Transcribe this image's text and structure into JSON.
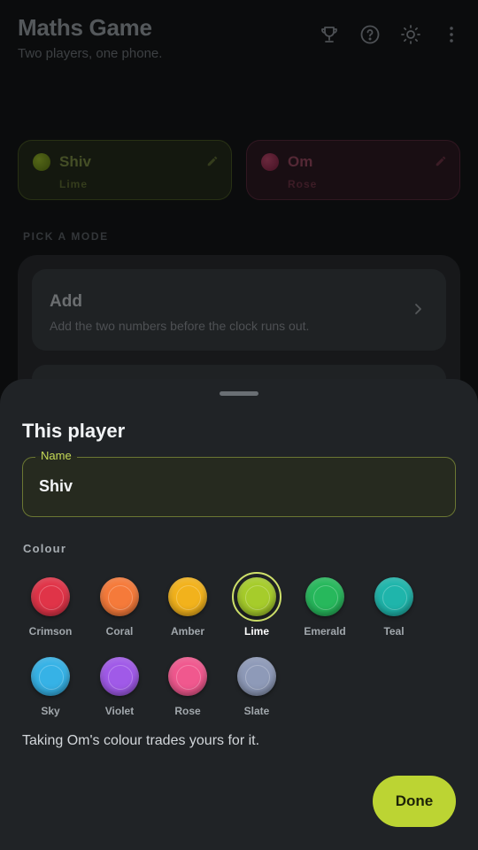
{
  "app": {
    "title": "Maths Game",
    "subtitle": "Two players, one phone.",
    "header_icons": [
      "trophy-icon",
      "help-icon",
      "brightness-icon",
      "more-vert-icon"
    ]
  },
  "players": [
    {
      "name": "Shiv",
      "colour_name": "Lime",
      "colour": "#8fb320",
      "text_color": "#7d8f45",
      "sub_color": "#5f6e34"
    },
    {
      "name": "Om",
      "colour_name": "Rose",
      "colour": "#b8355e",
      "text_color": "#9a4a62",
      "sub_color": "#6e3345"
    }
  ],
  "modes": {
    "section_label": "PICK A MODE",
    "items": [
      {
        "title": "Add",
        "description": "Add the two numbers before the clock runs out."
      }
    ]
  },
  "sheet": {
    "title": "This player",
    "name_field": {
      "label": "Name",
      "value": "Shiv"
    },
    "colour_label": "Colour",
    "colours": [
      {
        "name": "Crimson",
        "hex": "#e03448",
        "selected": false
      },
      {
        "name": "Coral",
        "hex": "#f57a3a",
        "selected": false
      },
      {
        "name": "Amber",
        "hex": "#f2b21c",
        "selected": false
      },
      {
        "name": "Lime",
        "hex": "#a6cc2b",
        "selected": true
      },
      {
        "name": "Emerald",
        "hex": "#27b85c",
        "selected": false
      },
      {
        "name": "Teal",
        "hex": "#1fb5ab",
        "selected": false
      },
      {
        "name": "Sky",
        "hex": "#36b2e6",
        "selected": false
      },
      {
        "name": "Violet",
        "hex": "#a05ae8",
        "selected": false
      },
      {
        "name": "Rose",
        "hex": "#f0588e",
        "selected": false
      },
      {
        "name": "Slate",
        "hex": "#8e9ab8",
        "selected": false
      }
    ],
    "note": "Taking Om's colour trades yours for it.",
    "done_label": "Done"
  },
  "theme": {
    "accent": "#bcd433",
    "sheet_bg": "#202326",
    "page_bg": "#151719"
  }
}
